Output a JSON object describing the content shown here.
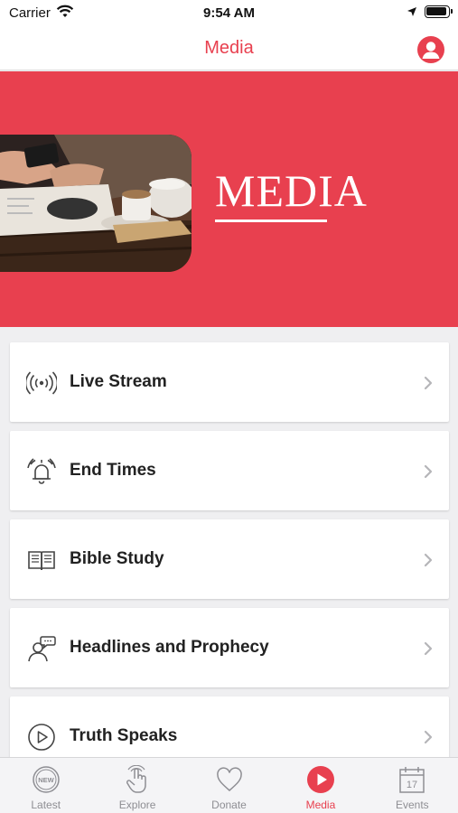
{
  "status_bar": {
    "carrier": "Carrier",
    "time": "9:54 AM"
  },
  "nav": {
    "title": "Media"
  },
  "hero": {
    "title": "MEDIA"
  },
  "menu": [
    {
      "label": "Live Stream",
      "icon": "broadcast-icon"
    },
    {
      "label": "End Times",
      "icon": "alarm-bell-icon"
    },
    {
      "label": "Bible Study",
      "icon": "open-book-icon"
    },
    {
      "label": "Headlines and Prophecy",
      "icon": "speaking-person-icon"
    },
    {
      "label": "Truth Speaks",
      "icon": "play-circle-icon"
    }
  ],
  "tabs": [
    {
      "label": "Latest",
      "icon": "new-badge-icon",
      "active": false
    },
    {
      "label": "Explore",
      "icon": "tap-hand-icon",
      "active": false
    },
    {
      "label": "Donate",
      "icon": "heart-icon",
      "active": false
    },
    {
      "label": "Media",
      "icon": "play-circle-icon",
      "active": true
    },
    {
      "label": "Events",
      "icon": "calendar-icon",
      "active": false
    }
  ],
  "colors": {
    "accent": "#e8404f",
    "inactive_tab": "#8e8e93",
    "background": "#efeff1"
  }
}
